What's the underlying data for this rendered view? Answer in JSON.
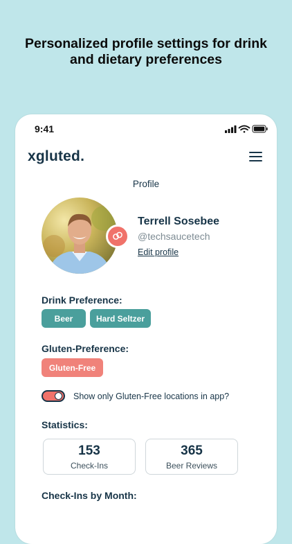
{
  "headline": {
    "line1": "Personalized profile settings for drink",
    "line2": "and dietary preferences"
  },
  "status_bar": {
    "time": "9:41",
    "icons": [
      "cellular-signal-icon",
      "wifi-icon",
      "battery-icon"
    ]
  },
  "header": {
    "brand": "xgluted.",
    "menu_icon": "hamburger-menu-icon"
  },
  "page_title": "Profile",
  "profile": {
    "name": "Terrell Sosebee",
    "handle": "@techsaucetech",
    "edit_label": "Edit profile",
    "badge_icon": "gluten-free-badge-icon"
  },
  "drink_preference": {
    "label": "Drink Preference:",
    "options": [
      "Beer",
      "Hard Seltzer"
    ]
  },
  "gluten_preference": {
    "label": "Gluten-Preference:",
    "options": [
      "Gluten-Free"
    ]
  },
  "toggle": {
    "label": "Show only Gluten-Free locations in app?",
    "on": true
  },
  "statistics": {
    "label": "Statistics:",
    "items": [
      {
        "value": "153",
        "label": "Check-Ins"
      },
      {
        "value": "365",
        "label": "Beer Reviews"
      }
    ]
  },
  "checkins_by_month": {
    "label": "Check-Ins by Month:"
  },
  "colors": {
    "background": "#bfe6ea",
    "navy": "#173447",
    "teal": "#4a9f9c",
    "coral": "#f0726a"
  }
}
